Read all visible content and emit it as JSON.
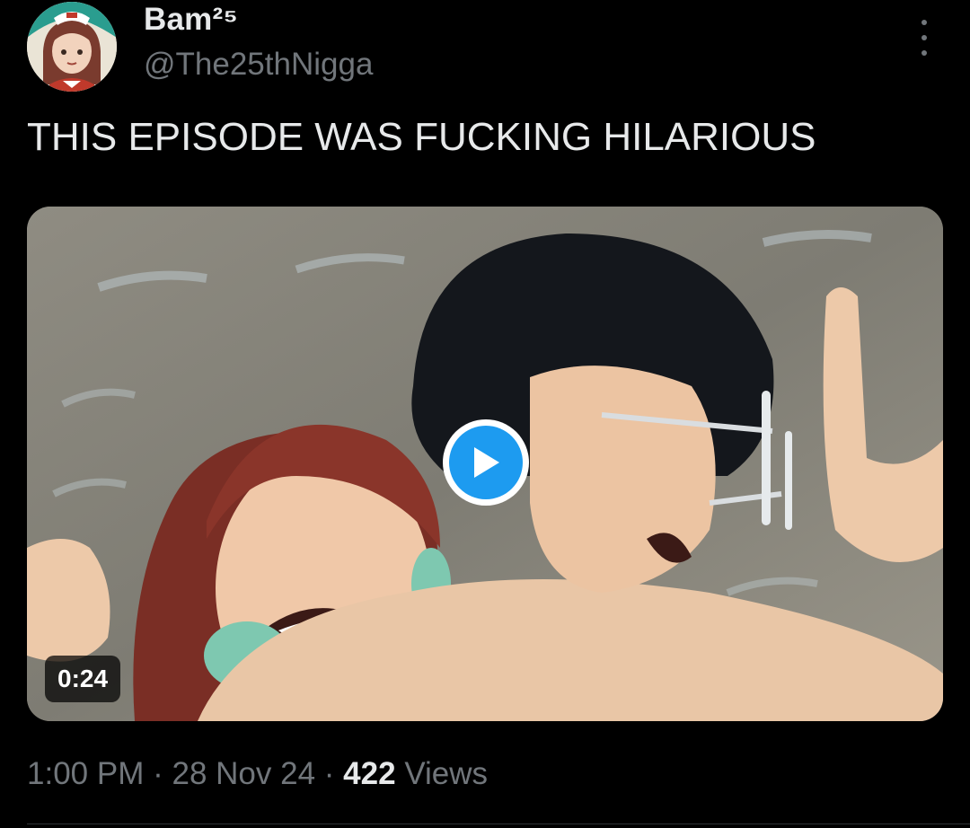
{
  "author": {
    "display_name": "Bam²⁵",
    "handle": "@The25thNigga",
    "avatar_icon": "avatar-anime-girl"
  },
  "tweet": {
    "text": "THIS EPISODE WAS FUCKING HILARIOUS"
  },
  "media": {
    "type": "video",
    "duration": "0:24",
    "play_icon": "play-icon"
  },
  "meta": {
    "time": "1:00 PM",
    "separator": "·",
    "date": "28 Nov 24",
    "views_count": "422",
    "views_label": "Views"
  },
  "colors": {
    "background": "#000000",
    "primary_text": "#e7e9ea",
    "secondary_text": "#71767b",
    "accent": "#1d9bf0"
  }
}
